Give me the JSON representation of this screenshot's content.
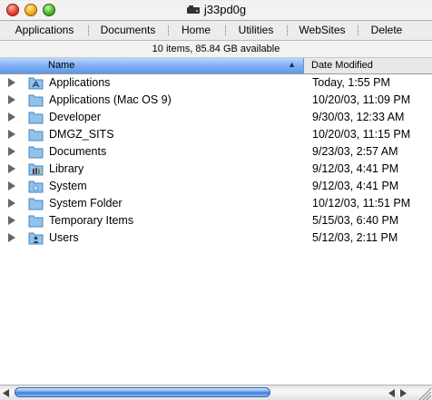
{
  "window": {
    "title": "j33pd0g"
  },
  "toolbar": {
    "buttons": [
      {
        "label": "Applications"
      },
      {
        "label": "Documents"
      },
      {
        "label": "Home"
      },
      {
        "label": "Utilities"
      },
      {
        "label": "WebSites"
      },
      {
        "label": "Delete"
      }
    ]
  },
  "status": {
    "text": "10 items, 85.84 GB available"
  },
  "columns": {
    "name": "Name",
    "date": "Date Modified",
    "sort": "ascending"
  },
  "files": [
    {
      "name": "Applications",
      "date": "Today, 1:55 PM",
      "icon": "applications-folder-icon"
    },
    {
      "name": "Applications (Mac OS 9)",
      "date": "10/20/03, 11:09 PM",
      "icon": "folder-icon"
    },
    {
      "name": "Developer",
      "date": "9/30/03, 12:33 AM",
      "icon": "folder-icon"
    },
    {
      "name": "DMGZ_SITS",
      "date": "10/20/03, 11:15 PM",
      "icon": "folder-icon"
    },
    {
      "name": "Documents",
      "date": "9/23/03, 2:57 AM",
      "icon": "folder-icon"
    },
    {
      "name": "Library",
      "date": "9/12/03, 4:41 PM",
      "icon": "library-folder-icon"
    },
    {
      "name": "System",
      "date": "9/12/03, 4:41 PM",
      "icon": "system-folder-icon"
    },
    {
      "name": "System Folder",
      "date": "10/12/03, 11:51 PM",
      "icon": "folder-icon"
    },
    {
      "name": "Temporary Items",
      "date": "5/15/03, 6:40 PM",
      "icon": "folder-icon"
    },
    {
      "name": "Users",
      "date": "5/12/03, 2:11 PM",
      "icon": "users-folder-icon"
    }
  ],
  "colors": {
    "selected_column": "#7fb0f2",
    "folder": "#8ec3ee",
    "scroll_thumb": "#4a87de"
  }
}
